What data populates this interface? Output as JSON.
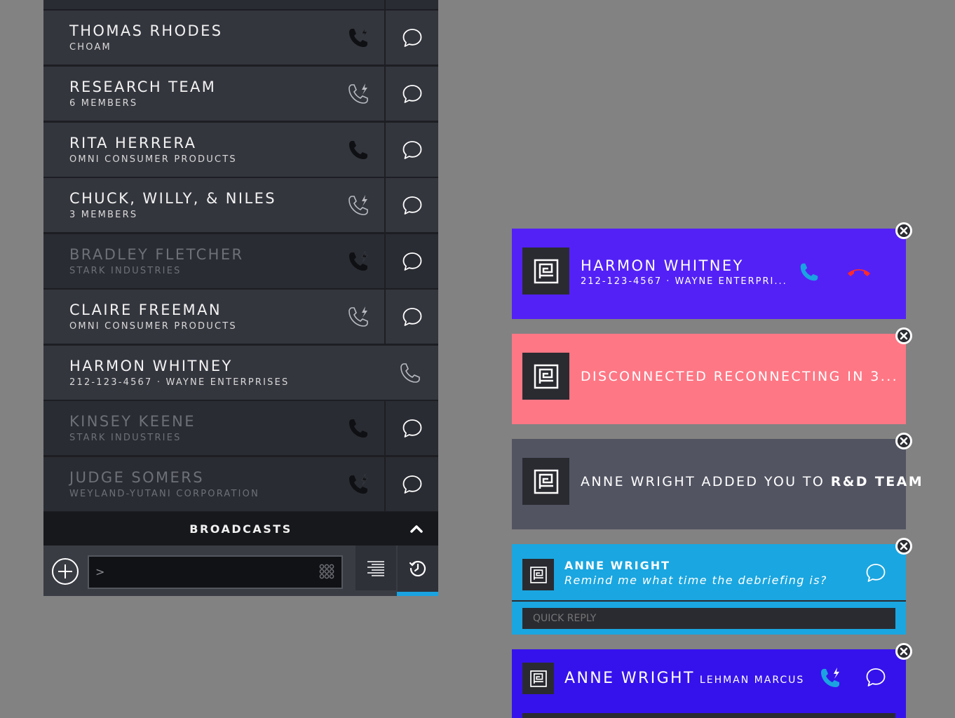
{
  "colors": {
    "background": "#828282",
    "row": "#34363e",
    "row_dim": "#2a2c33",
    "accent_blue": "#1aa3e0",
    "incoming_call": "#5321f6",
    "disconnected": "#fe7785",
    "added": "#525462",
    "message": "#1aa6e0",
    "call_alert": "#3512ec",
    "hangup_red": "#ff2a2a"
  },
  "contacts": [
    {
      "name": "THOMAS RHODES",
      "sub": "CHOAM",
      "status": "active",
      "phone_icon": "phone-missed-icon",
      "chat": true
    },
    {
      "name": "RESEARCH TEAM",
      "sub": "6 MEMBERS",
      "status": "active",
      "phone_icon": "phone-outgoing-outline-icon",
      "chat": true
    },
    {
      "name": "RITA HERRERA",
      "sub": "OMNI CONSUMER PRODUCTS",
      "status": "active",
      "phone_icon": "phone-icon",
      "chat": true
    },
    {
      "name": "CHUCK, WILLY, & NILES",
      "sub": "3 MEMBERS",
      "status": "active",
      "phone_icon": "phone-outgoing-outline-icon",
      "chat": true
    },
    {
      "name": "BRADLEY FLETCHER",
      "sub": "STARK INDUSTRIES",
      "status": "offline",
      "phone_icon": "phone-missed-icon",
      "chat": true
    },
    {
      "name": "CLAIRE FREEMAN",
      "sub": "OMNI CONSUMER PRODUCTS",
      "status": "active",
      "phone_icon": "phone-outgoing-outline-icon",
      "chat": true
    },
    {
      "name": "HARMON WHITNEY",
      "sub": "212-123-4567 · WAYNE ENTERPRISES",
      "status": "active",
      "phone_icon": "phone-outline-icon",
      "chat": false
    },
    {
      "name": "KINSEY KEENE",
      "sub": "STARK INDUSTRIES",
      "status": "offline",
      "phone_icon": "phone-icon",
      "chat": true
    },
    {
      "name": "JUDGE SOMERS",
      "sub": "WEYLAND-YUTANI CORPORATION",
      "status": "offline",
      "phone_icon": "phone-missed-icon",
      "chat": true
    }
  ],
  "broadcasts": {
    "label": "BROADCASTS",
    "icon": "chevron-up-icon"
  },
  "composer": {
    "prompt": ">",
    "placeholder": "",
    "value": ""
  },
  "notifications": {
    "incoming_call": {
      "title": "HARMON WHITNEY",
      "sub": "212-123-4567 · WAYNE ENTERPRI..."
    },
    "disconnected": {
      "text": "DISCONNECTED RECONNECTING IN 3..."
    },
    "added": {
      "prefix": "ANNE WRIGHT ADDED YOU TO ",
      "team": "R&D TEAM"
    },
    "message": {
      "sender": "ANNE WRIGHT",
      "body": "Remind me what time the debriefing is?",
      "quick_reply_placeholder": "QUICK REPLY"
    },
    "call_alert": {
      "title": "ANNE WRIGHT",
      "company": "LEHMAN MARCUS"
    }
  }
}
